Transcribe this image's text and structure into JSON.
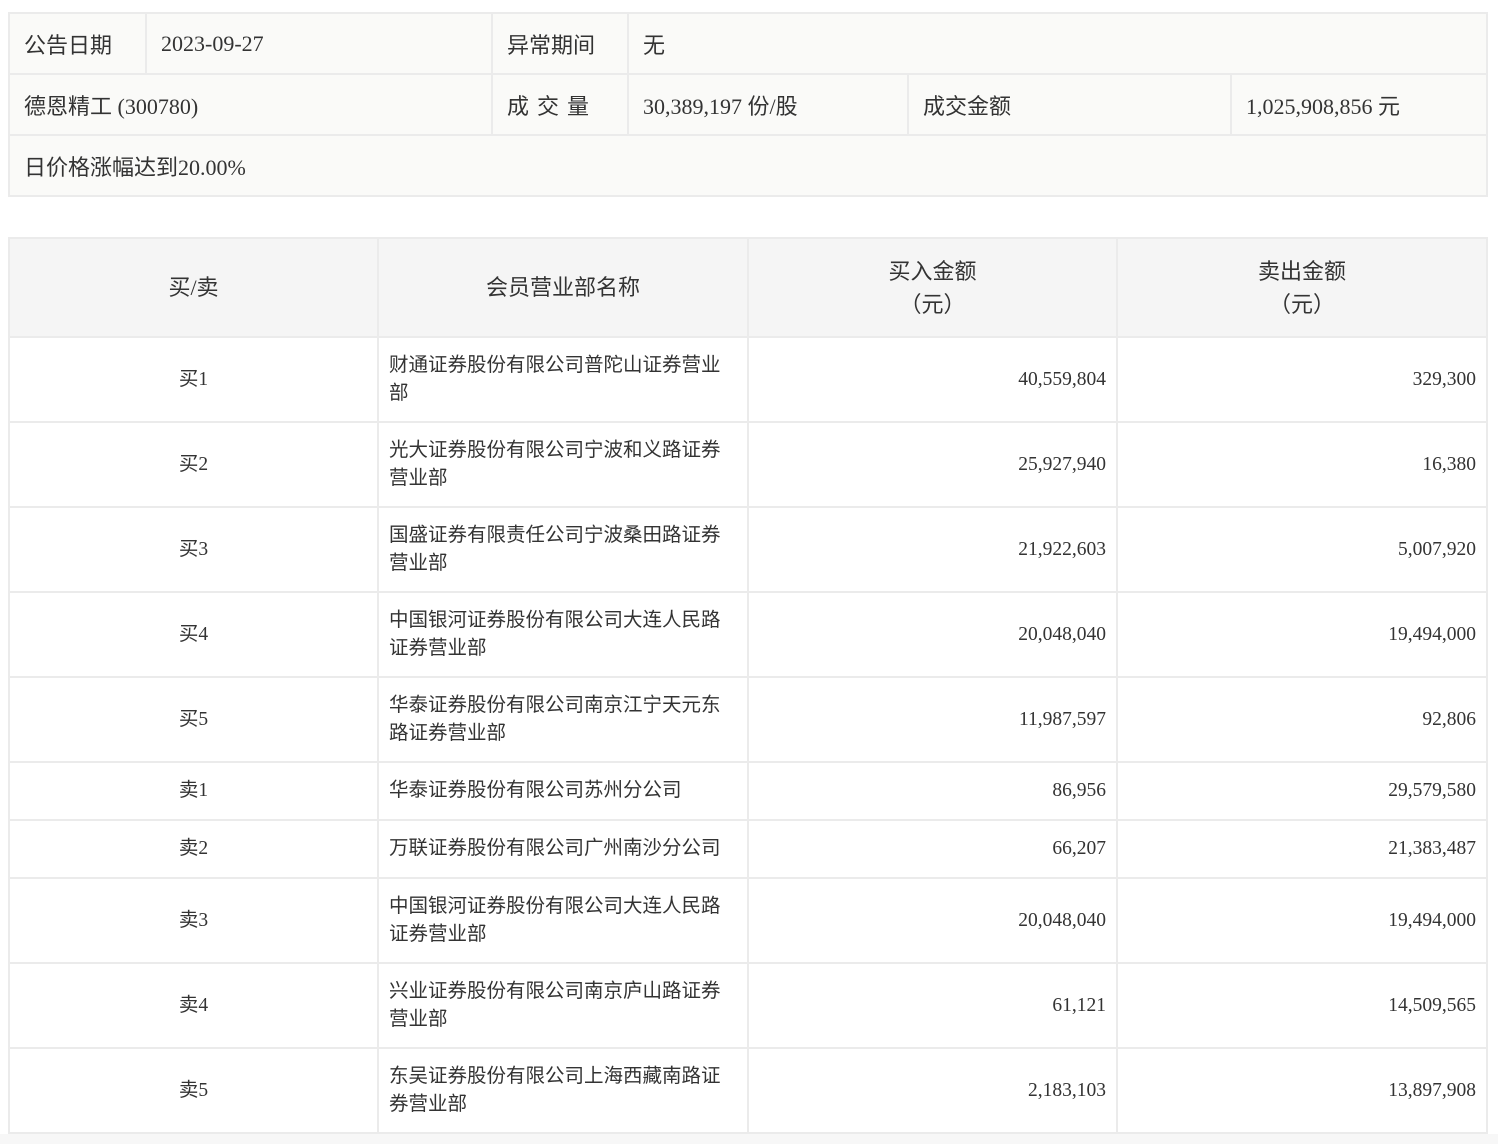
{
  "info": {
    "announce_date_label": "公告日期",
    "announce_date": "2023-09-27",
    "abnormal_period_label": "异常期间",
    "abnormal_period": "无",
    "stock": "德恩精工 (300780)",
    "volume_label": "成交量",
    "volume": "30,389,197 份/股",
    "amount_label": "成交金额",
    "amount": "1,025,908,856 元",
    "reason": "日价格涨幅达到20.00%"
  },
  "trade_table": {
    "headers": {
      "side": "买/卖",
      "name": "会员营业部名称",
      "buy": "买入金额",
      "buy_unit": "（元）",
      "sell": "卖出金额",
      "sell_unit": "（元）"
    },
    "rows": [
      {
        "side": "买1",
        "name": "财通证券股份有限公司普陀山证券营业部",
        "buy": "40,559,804",
        "sell": "329,300"
      },
      {
        "side": "买2",
        "name": "光大证券股份有限公司宁波和义路证券营业部",
        "buy": "25,927,940",
        "sell": "16,380"
      },
      {
        "side": "买3",
        "name": "国盛证券有限责任公司宁波桑田路证券营业部",
        "buy": "21,922,603",
        "sell": "5,007,920"
      },
      {
        "side": "买4",
        "name": "中国银河证券股份有限公司大连人民路证券营业部",
        "buy": "20,048,040",
        "sell": "19,494,000"
      },
      {
        "side": "买5",
        "name": "华泰证券股份有限公司南京江宁天元东路证券营业部",
        "buy": "11,987,597",
        "sell": "92,806"
      },
      {
        "side": "卖1",
        "name": "华泰证券股份有限公司苏州分公司",
        "buy": "86,956",
        "sell": "29,579,580"
      },
      {
        "side": "卖2",
        "name": "万联证券股份有限公司广州南沙分公司",
        "buy": "66,207",
        "sell": "21,383,487"
      },
      {
        "side": "卖3",
        "name": "中国银河证券股份有限公司大连人民路证券营业部",
        "buy": "20,048,040",
        "sell": "19,494,000"
      },
      {
        "side": "卖4",
        "name": "兴业证券股份有限公司南京庐山路证券营业部",
        "buy": "61,121",
        "sell": "14,509,565"
      },
      {
        "side": "卖5",
        "name": "东吴证券股份有限公司上海西藏南路证券营业部",
        "buy": "2,183,103",
        "sell": "13,897,908"
      }
    ]
  }
}
